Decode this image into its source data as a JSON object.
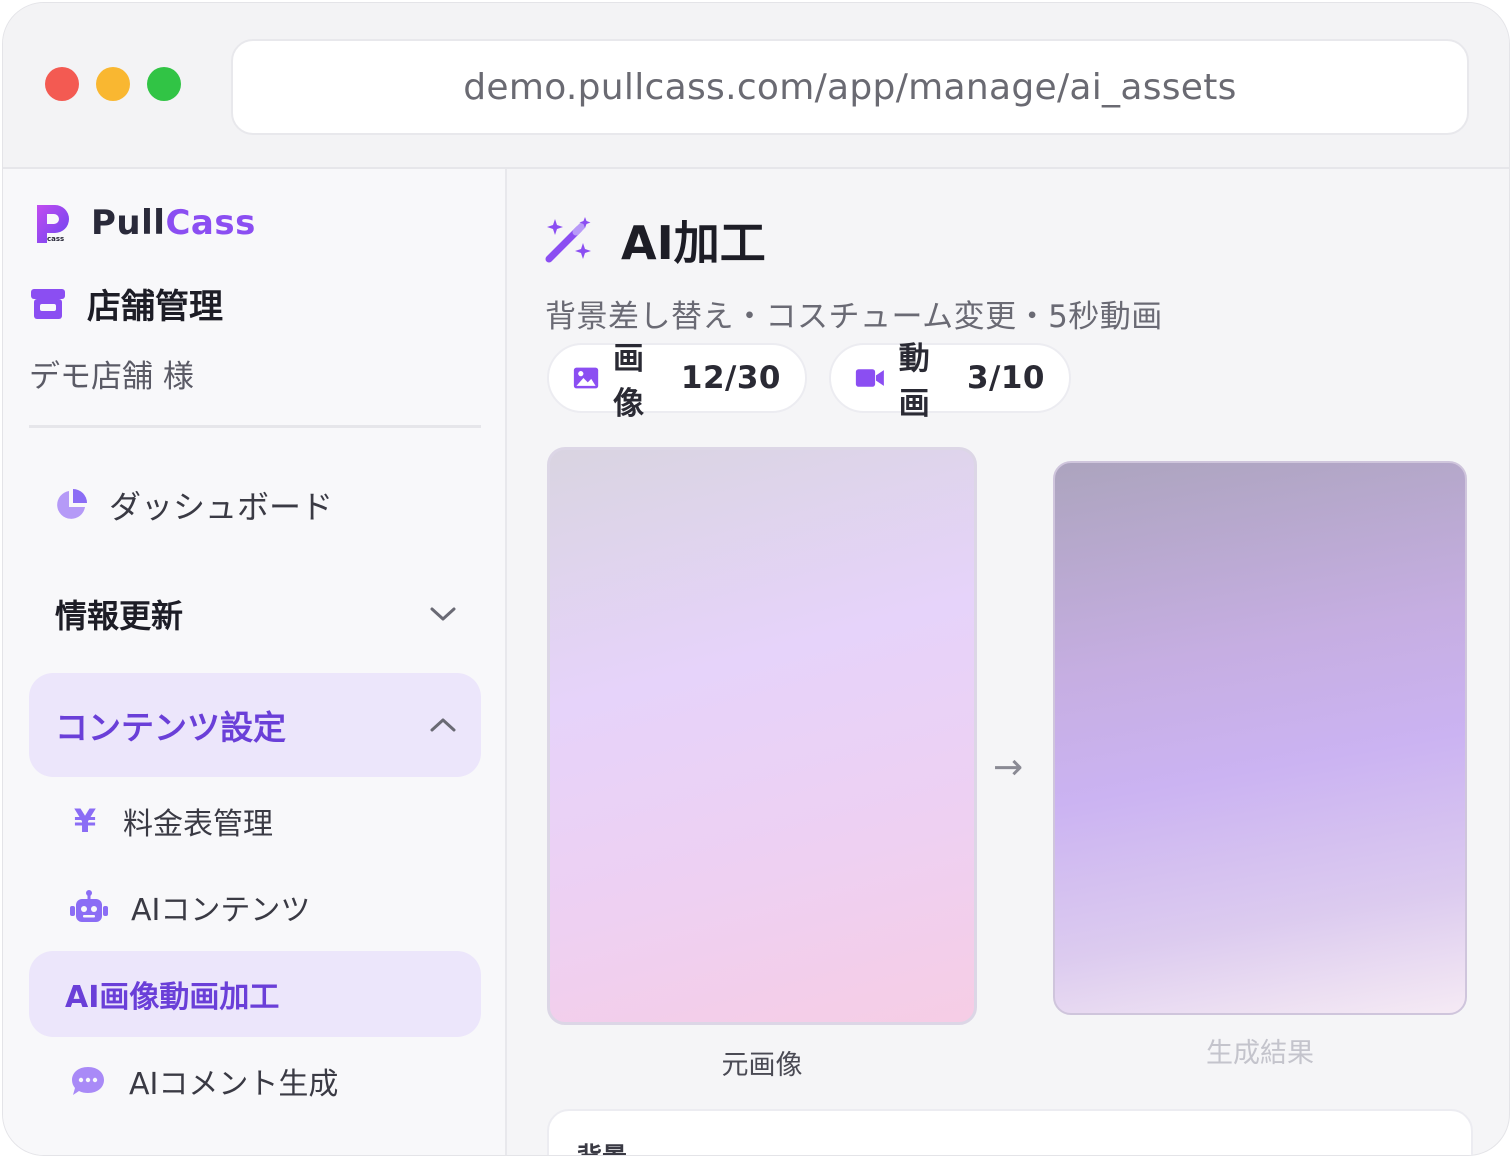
{
  "browser": {
    "url": "demo.pullcass.com/app/manage/ai_assets"
  },
  "sidebar": {
    "brand": {
      "part1": "Pull",
      "part2": "Cass",
      "logo_text": "cass"
    },
    "store_title": "店舗管理",
    "store_name": "デモ店舗 様",
    "nav": {
      "dashboard": "ダッシュボード",
      "info_update": "情報更新",
      "content_settings": "コンテンツ設定",
      "price_mgmt": "料金表管理",
      "price_icon": "¥",
      "ai_content": "AIコンテンツ",
      "ai_media": "AI画像動画加工",
      "ai_comment": "AIコメント生成"
    }
  },
  "main": {
    "title": "AI加工",
    "subtitle": "背景差し替え・コスチューム変更・5秒動画",
    "quota_image": {
      "label": "画像",
      "count": "12/30"
    },
    "quota_video": {
      "label": "動画",
      "count": "3/10"
    },
    "arrow": "→",
    "source_caption": "元画像",
    "result_caption": "生成結果",
    "panel_label": "背景"
  },
  "colors": {
    "accent": "#8b4ef2",
    "accent_text": "#6a3fd8",
    "active_bg": "#ece6fb",
    "icon": "#8b6df5"
  },
  "icons": [
    "wand-sparkle-icon",
    "store-icon",
    "pie-chart-icon",
    "chevron-down-icon",
    "chevron-up-icon",
    "yen-icon",
    "robot-icon",
    "chat-bubble-icon",
    "image-icon",
    "video-camera-icon"
  ]
}
